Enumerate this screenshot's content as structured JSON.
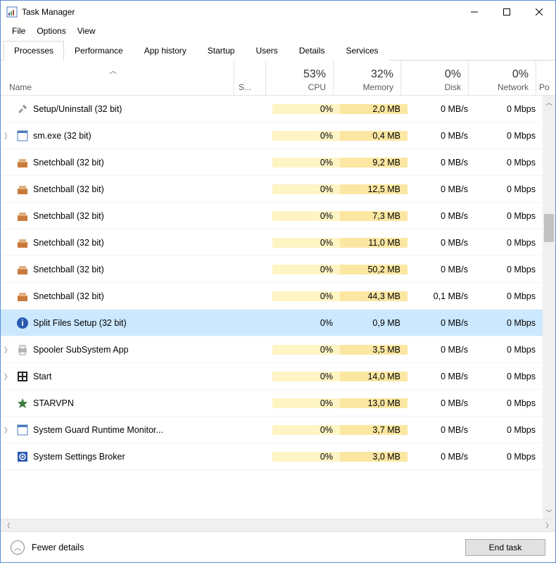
{
  "window": {
    "title": "Task Manager"
  },
  "menubar": {
    "items": [
      "File",
      "Options",
      "View"
    ]
  },
  "tabs": {
    "items": [
      "Processes",
      "Performance",
      "App history",
      "Startup",
      "Users",
      "Details",
      "Services"
    ],
    "active": 0
  },
  "header": {
    "name_label": "Name",
    "status_label": "S...",
    "cols": [
      {
        "pct": "53%",
        "label": "CPU"
      },
      {
        "pct": "32%",
        "label": "Memory"
      },
      {
        "pct": "0%",
        "label": "Disk"
      },
      {
        "pct": "0%",
        "label": "Network"
      }
    ],
    "extra_col": "Po"
  },
  "processes": [
    {
      "name": "Setup/Uninstall (32 bit)",
      "cpu": "0%",
      "mem": "2,0 MB",
      "disk": "0 MB/s",
      "net": "0 Mbps",
      "exp": false,
      "icon": "setup"
    },
    {
      "name": "sm.exe (32 bit)",
      "cpu": "0%",
      "mem": "0,4 MB",
      "disk": "0 MB/s",
      "net": "0 Mbps",
      "exp": true,
      "icon": "generic"
    },
    {
      "name": "Snetchball (32 bit)",
      "cpu": "0%",
      "mem": "9,2 MB",
      "disk": "0 MB/s",
      "net": "0 Mbps",
      "exp": false,
      "icon": "snetch"
    },
    {
      "name": "Snetchball (32 bit)",
      "cpu": "0%",
      "mem": "12,5 MB",
      "disk": "0 MB/s",
      "net": "0 Mbps",
      "exp": false,
      "icon": "snetch"
    },
    {
      "name": "Snetchball (32 bit)",
      "cpu": "0%",
      "mem": "7,3 MB",
      "disk": "0 MB/s",
      "net": "0 Mbps",
      "exp": false,
      "icon": "snetch"
    },
    {
      "name": "Snetchball (32 bit)",
      "cpu": "0%",
      "mem": "11,0 MB",
      "disk": "0 MB/s",
      "net": "0 Mbps",
      "exp": false,
      "icon": "snetch"
    },
    {
      "name": "Snetchball (32 bit)",
      "cpu": "0%",
      "mem": "50,2 MB",
      "disk": "0 MB/s",
      "net": "0 Mbps",
      "exp": false,
      "icon": "snetch"
    },
    {
      "name": "Snetchball (32 bit)",
      "cpu": "0%",
      "mem": "44,3 MB",
      "disk": "0,1 MB/s",
      "net": "0 Mbps",
      "exp": false,
      "icon": "snetch"
    },
    {
      "name": "Split Files Setup (32 bit)",
      "cpu": "0%",
      "mem": "0,9 MB",
      "disk": "0 MB/s",
      "net": "0 Mbps",
      "exp": false,
      "icon": "info",
      "selected": true
    },
    {
      "name": "Spooler SubSystem App",
      "cpu": "0%",
      "mem": "3,5 MB",
      "disk": "0 MB/s",
      "net": "0 Mbps",
      "exp": true,
      "icon": "printer"
    },
    {
      "name": "Start",
      "cpu": "0%",
      "mem": "14,0 MB",
      "disk": "0 MB/s",
      "net": "0 Mbps",
      "exp": true,
      "icon": "start"
    },
    {
      "name": "STARVPN",
      "cpu": "0%",
      "mem": "13,0 MB",
      "disk": "0 MB/s",
      "net": "0 Mbps",
      "exp": false,
      "icon": "star"
    },
    {
      "name": "System Guard Runtime Monitor...",
      "cpu": "0%",
      "mem": "3,7 MB",
      "disk": "0 MB/s",
      "net": "0 Mbps",
      "exp": true,
      "icon": "generic"
    },
    {
      "name": "System Settings Broker",
      "cpu": "0%",
      "mem": "3,0 MB",
      "disk": "0 MB/s",
      "net": "0 Mbps",
      "exp": false,
      "icon": "gear"
    }
  ],
  "footer": {
    "fewer_details": "Fewer details",
    "end_task": "End task"
  }
}
